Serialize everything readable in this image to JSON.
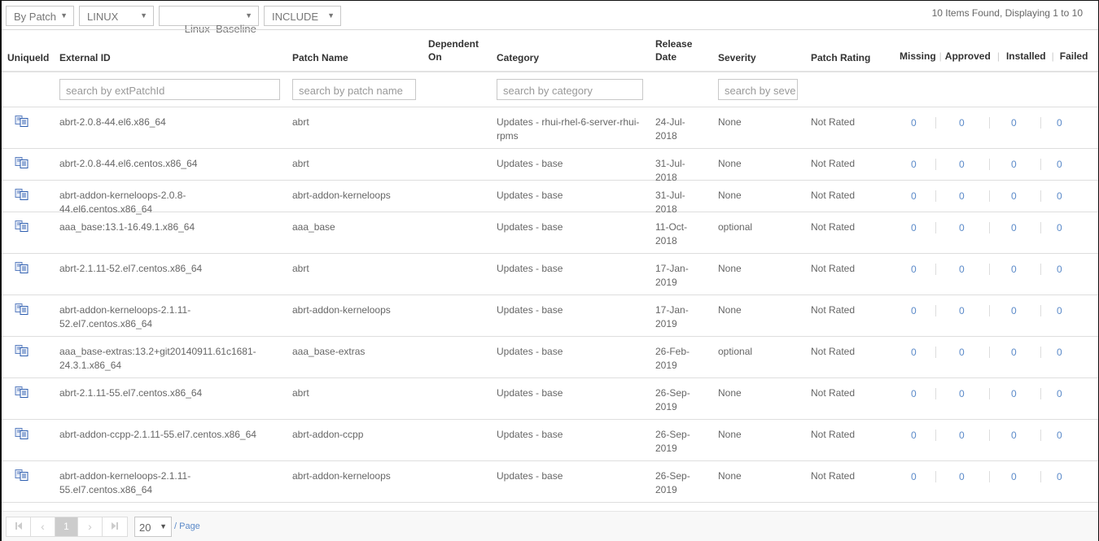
{
  "toolbar": {
    "view_select": "By Patch",
    "os_select": "LINUX",
    "baseline_select": "Linux  Baseline",
    "mode_select": "INCLUDE",
    "count_text": "10 Items Found, Displaying 1 to 10"
  },
  "columns": {
    "unique_id": "UniqueId",
    "external_id": "External ID",
    "patch_name": "Patch Name",
    "dependent_on_1": "Dependent",
    "dependent_on_2": "On",
    "category": "Category",
    "release_date_1": "Release",
    "release_date_2": "Date",
    "severity": "Severity",
    "patch_rating": "Patch Rating",
    "missing": "Missing",
    "approved": "Approved",
    "installed": "Installed",
    "failed": "Failed",
    "separator": "|"
  },
  "filters": {
    "external_id_placeholder": "search by extPatchId",
    "patch_name_placeholder": "search by patch name",
    "category_placeholder": "search by category",
    "severity_placeholder": "search by seve"
  },
  "rows": [
    {
      "external_id": "abrt-2.0.8-44.el6.x86_64",
      "patch_name": "abrt",
      "dependent_on": "",
      "category": "Updates - rhui-rhel-6-server-rhui-rpms",
      "release_date": "24-Jul-2018",
      "severity": "None",
      "patch_rating": "Not Rated",
      "missing": "0",
      "approved": "0",
      "installed": "0",
      "failed": "0"
    },
    {
      "external_id": "abrt-2.0.8-44.el6.centos.x86_64",
      "patch_name": "abrt",
      "dependent_on": "",
      "category": "Updates - base",
      "release_date": "31-Jul-2018",
      "severity": "None",
      "patch_rating": "Not Rated",
      "missing": "0",
      "approved": "0",
      "installed": "0",
      "failed": "0"
    },
    {
      "external_id": "abrt-addon-kerneloops-2.0.8-44.el6.centos.x86_64",
      "patch_name": "abrt-addon-kerneloops",
      "dependent_on": "",
      "category": "Updates - base",
      "release_date": "31-Jul-2018",
      "severity": "None",
      "patch_rating": "Not Rated",
      "missing": "0",
      "approved": "0",
      "installed": "0",
      "failed": "0"
    },
    {
      "external_id": "aaa_base:13.1-16.49.1.x86_64",
      "patch_name": "aaa_base",
      "dependent_on": "",
      "category": "Updates - base",
      "release_date": "11-Oct-2018",
      "severity": "optional",
      "patch_rating": "Not Rated",
      "missing": "0",
      "approved": "0",
      "installed": "0",
      "failed": "0"
    },
    {
      "external_id": "abrt-2.1.11-52.el7.centos.x86_64",
      "patch_name": "abrt",
      "dependent_on": "",
      "category": "Updates - base",
      "release_date": "17-Jan-2019",
      "severity": "None",
      "patch_rating": "Not Rated",
      "missing": "0",
      "approved": "0",
      "installed": "0",
      "failed": "0"
    },
    {
      "external_id": "abrt-addon-kerneloops-2.1.11-52.el7.centos.x86_64",
      "patch_name": "abrt-addon-kerneloops",
      "dependent_on": "",
      "category": "Updates - base",
      "release_date": "17-Jan-2019",
      "severity": "None",
      "patch_rating": "Not Rated",
      "missing": "0",
      "approved": "0",
      "installed": "0",
      "failed": "0"
    },
    {
      "external_id": "aaa_base-extras:13.2+git20140911.61c1681-24.3.1.x86_64",
      "patch_name": "aaa_base-extras",
      "dependent_on": "",
      "category": "Updates - base",
      "release_date": "26-Feb-2019",
      "severity": "optional",
      "patch_rating": "Not Rated",
      "missing": "0",
      "approved": "0",
      "installed": "0",
      "failed": "0"
    },
    {
      "external_id": "abrt-2.1.11-55.el7.centos.x86_64",
      "patch_name": "abrt",
      "dependent_on": "",
      "category": "Updates - base",
      "release_date": "26-Sep-2019",
      "severity": "None",
      "patch_rating": "Not Rated",
      "missing": "0",
      "approved": "0",
      "installed": "0",
      "failed": "0"
    },
    {
      "external_id": "abrt-addon-ccpp-2.1.11-55.el7.centos.x86_64",
      "patch_name": "abrt-addon-ccpp",
      "dependent_on": "",
      "category": "Updates - base",
      "release_date": "26-Sep-2019",
      "severity": "None",
      "patch_rating": "Not Rated",
      "missing": "0",
      "approved": "0",
      "installed": "0",
      "failed": "0"
    },
    {
      "external_id": "abrt-addon-kerneloops-2.1.11-55.el7.centos.x86_64",
      "patch_name": "abrt-addon-kerneloops",
      "dependent_on": "",
      "category": "Updates - base",
      "release_date": "26-Sep-2019",
      "severity": "None",
      "patch_rating": "Not Rated",
      "missing": "0",
      "approved": "0",
      "installed": "0",
      "failed": "0"
    }
  ],
  "pagination": {
    "first": "⏮",
    "prev": "‹",
    "current_page": "1",
    "next": "›",
    "last": "⏭",
    "page_size": "20",
    "per_page_label": "/ Page"
  },
  "icons": {
    "row_icon": "copy-documents-icon",
    "dropdown_arrow": "▼"
  },
  "colors": {
    "link_blue": "#5b8ac9",
    "header_text": "#333333",
    "body_text": "#666666",
    "active_page_bg": "#cccccc"
  }
}
